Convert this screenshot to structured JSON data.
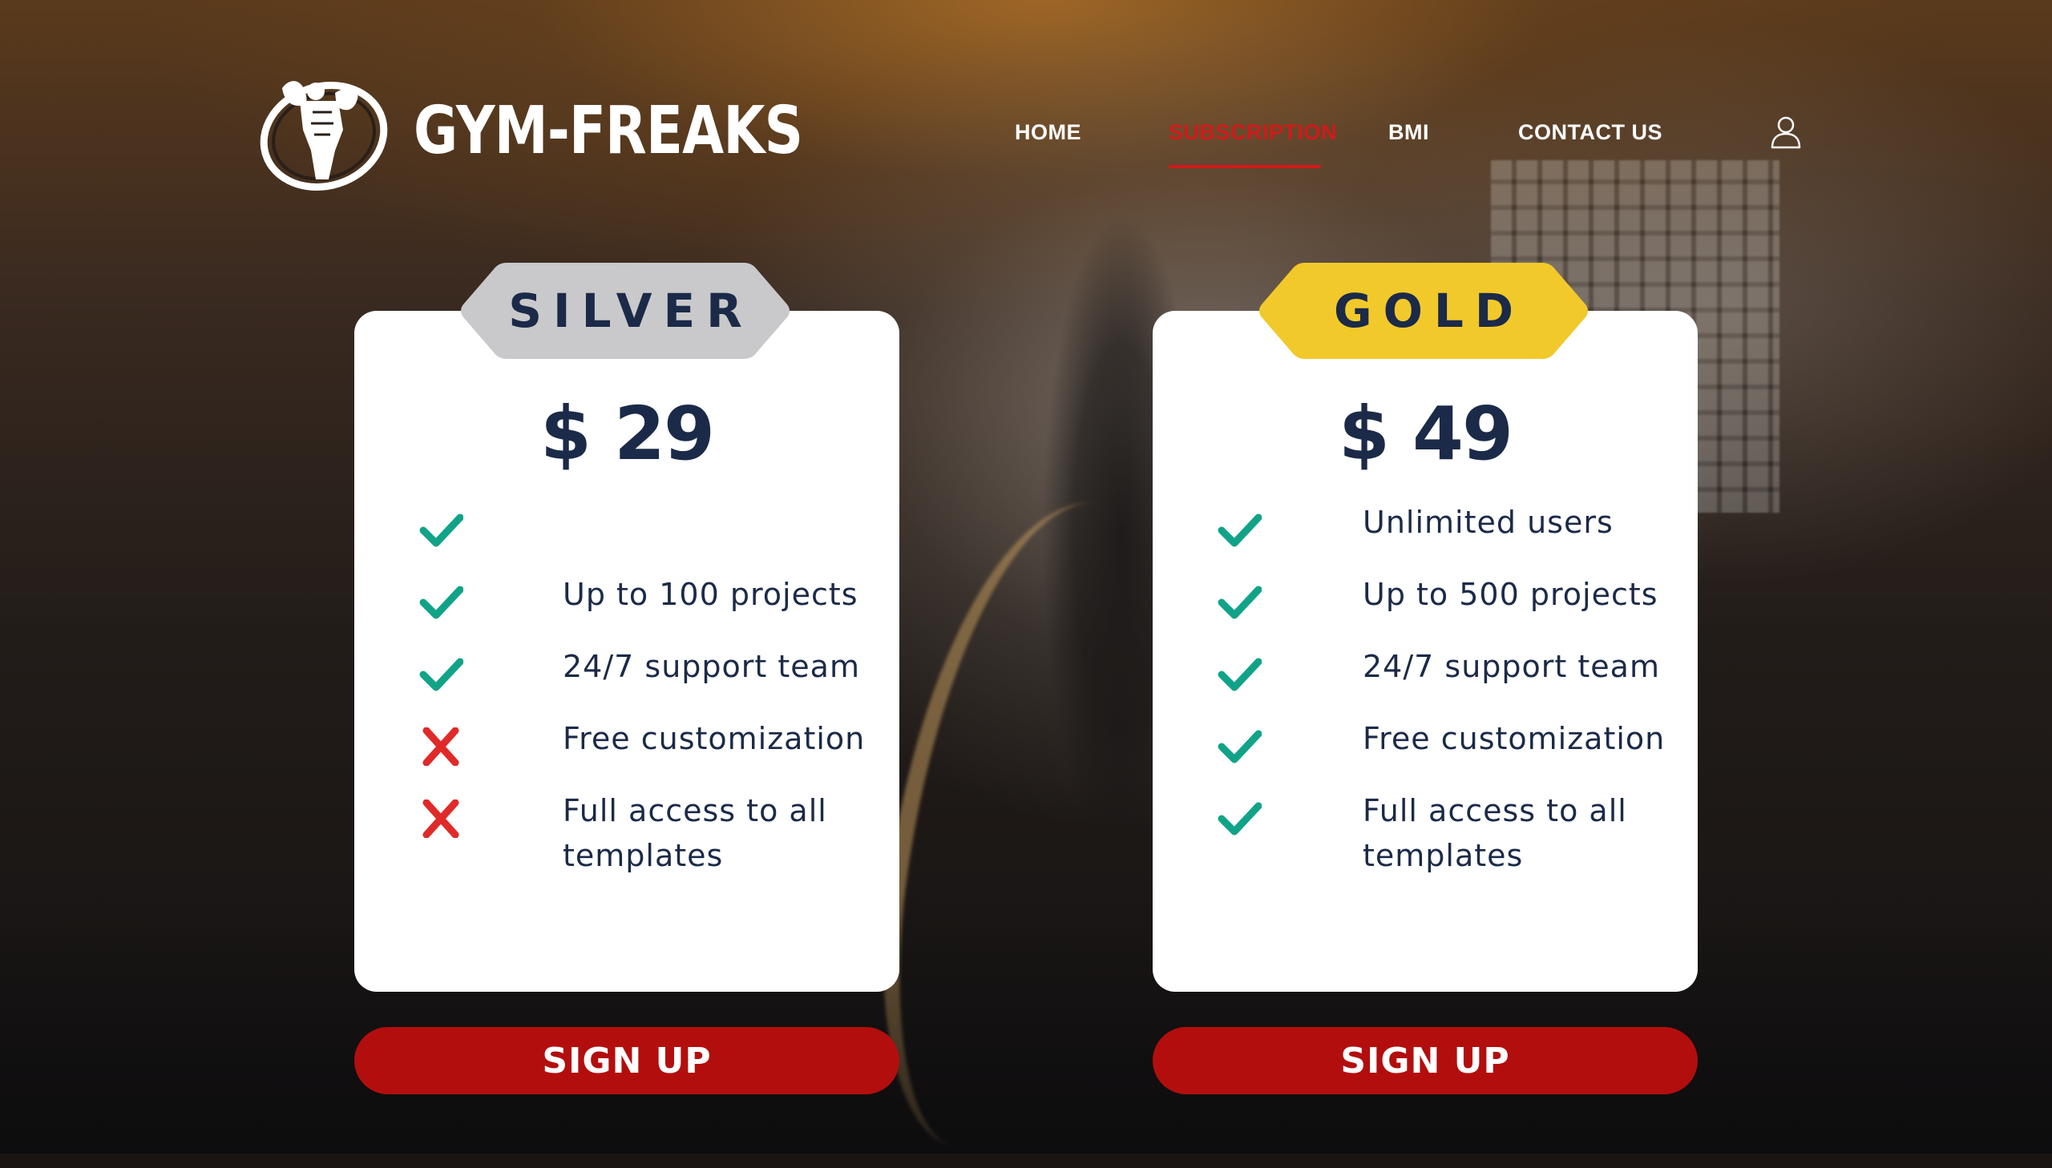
{
  "brand": {
    "name": "GYM-FREAKS",
    "logo_icon": "bodybuilder-emblem-icon"
  },
  "nav": {
    "items": [
      {
        "label": "HOME",
        "active": false
      },
      {
        "label": "SUBSCRIPTION",
        "active": true
      },
      {
        "label": "BMI",
        "active": false
      },
      {
        "label": "CONTACT US",
        "active": false
      }
    ],
    "account_icon": "user-icon"
  },
  "colors": {
    "accent_red": "#d11a1a",
    "button_red": "#b30e0e",
    "text_navy": "#1b2a48",
    "check_green": "#11a388",
    "cross_red": "#e02a2a",
    "silver_badge": "#c9c9cb",
    "gold_badge": "#f1c92b"
  },
  "plans": [
    {
      "name": "SILVER",
      "price": "$ 29",
      "features": [
        {
          "text": "",
          "included": true
        },
        {
          "text": "Up to 100 projects",
          "included": true
        },
        {
          "text": "24/7 support team",
          "included": true
        },
        {
          "text": "Free customization",
          "included": false
        },
        {
          "text": "Full access to all templates",
          "included": false
        }
      ],
      "cta": "SIGN UP"
    },
    {
      "name": "GOLD",
      "price": "$ 49",
      "features": [
        {
          "text": "Unlimited users",
          "included": true
        },
        {
          "text": "Up to 500 projects",
          "included": true
        },
        {
          "text": "24/7 support team",
          "included": true
        },
        {
          "text": "Free customization",
          "included": true
        },
        {
          "text": "Full access to all templates",
          "included": true
        }
      ],
      "cta": "SIGN UP"
    }
  ]
}
